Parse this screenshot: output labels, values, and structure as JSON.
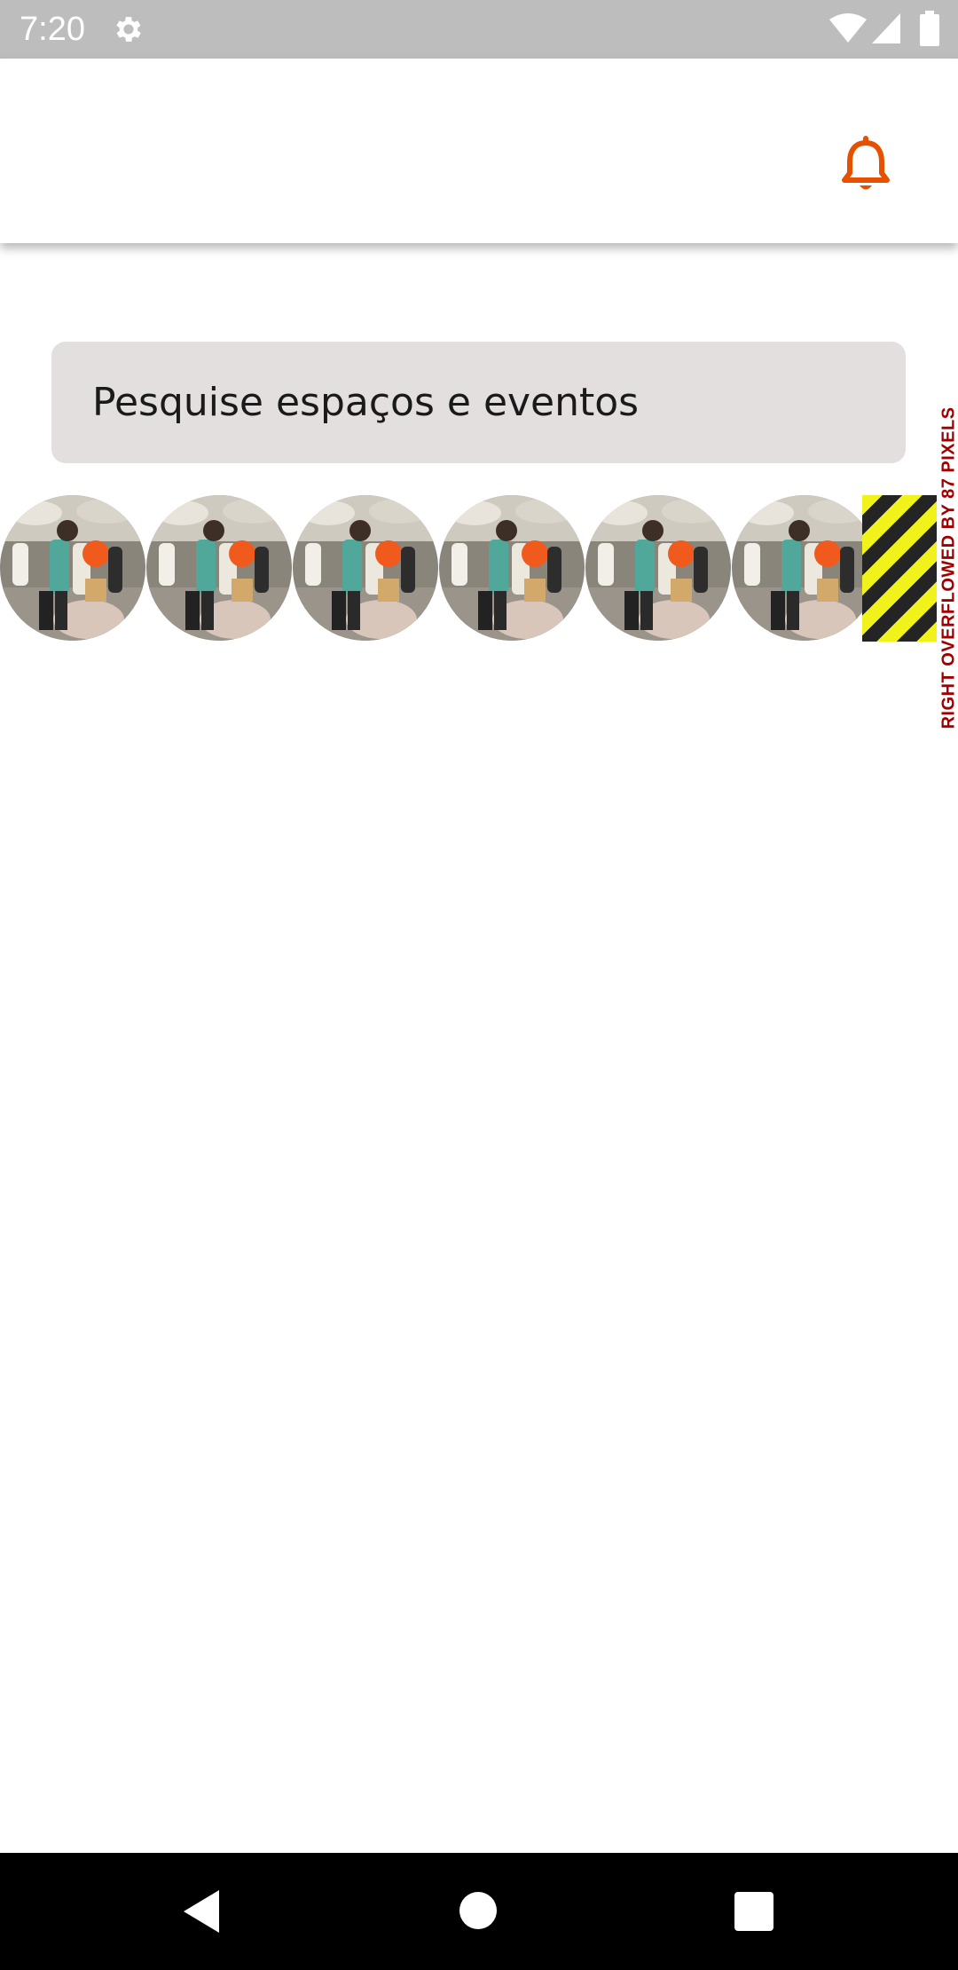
{
  "status_bar": {
    "time": "7:20",
    "icons": [
      "gear-icon",
      "wifi-icon",
      "signal-icon",
      "battery-icon"
    ]
  },
  "app_bar": {
    "notification_icon": "bell-icon",
    "accent_color": "#e65100"
  },
  "search": {
    "placeholder": "Pesquise espaços e eventos"
  },
  "stories": {
    "items": [
      {
        "image": "crowd-festival-photo"
      },
      {
        "image": "crowd-festival-photo"
      },
      {
        "image": "crowd-festival-photo"
      },
      {
        "image": "crowd-festival-photo"
      },
      {
        "image": "crowd-festival-photo"
      },
      {
        "image": "crowd-festival-photo"
      }
    ]
  },
  "debug": {
    "overflow_message": "RIGHT OVERFLOWED BY 87 PIXELS"
  },
  "nav_bar": {
    "icons": [
      "back-icon",
      "home-icon",
      "recents-icon"
    ]
  }
}
